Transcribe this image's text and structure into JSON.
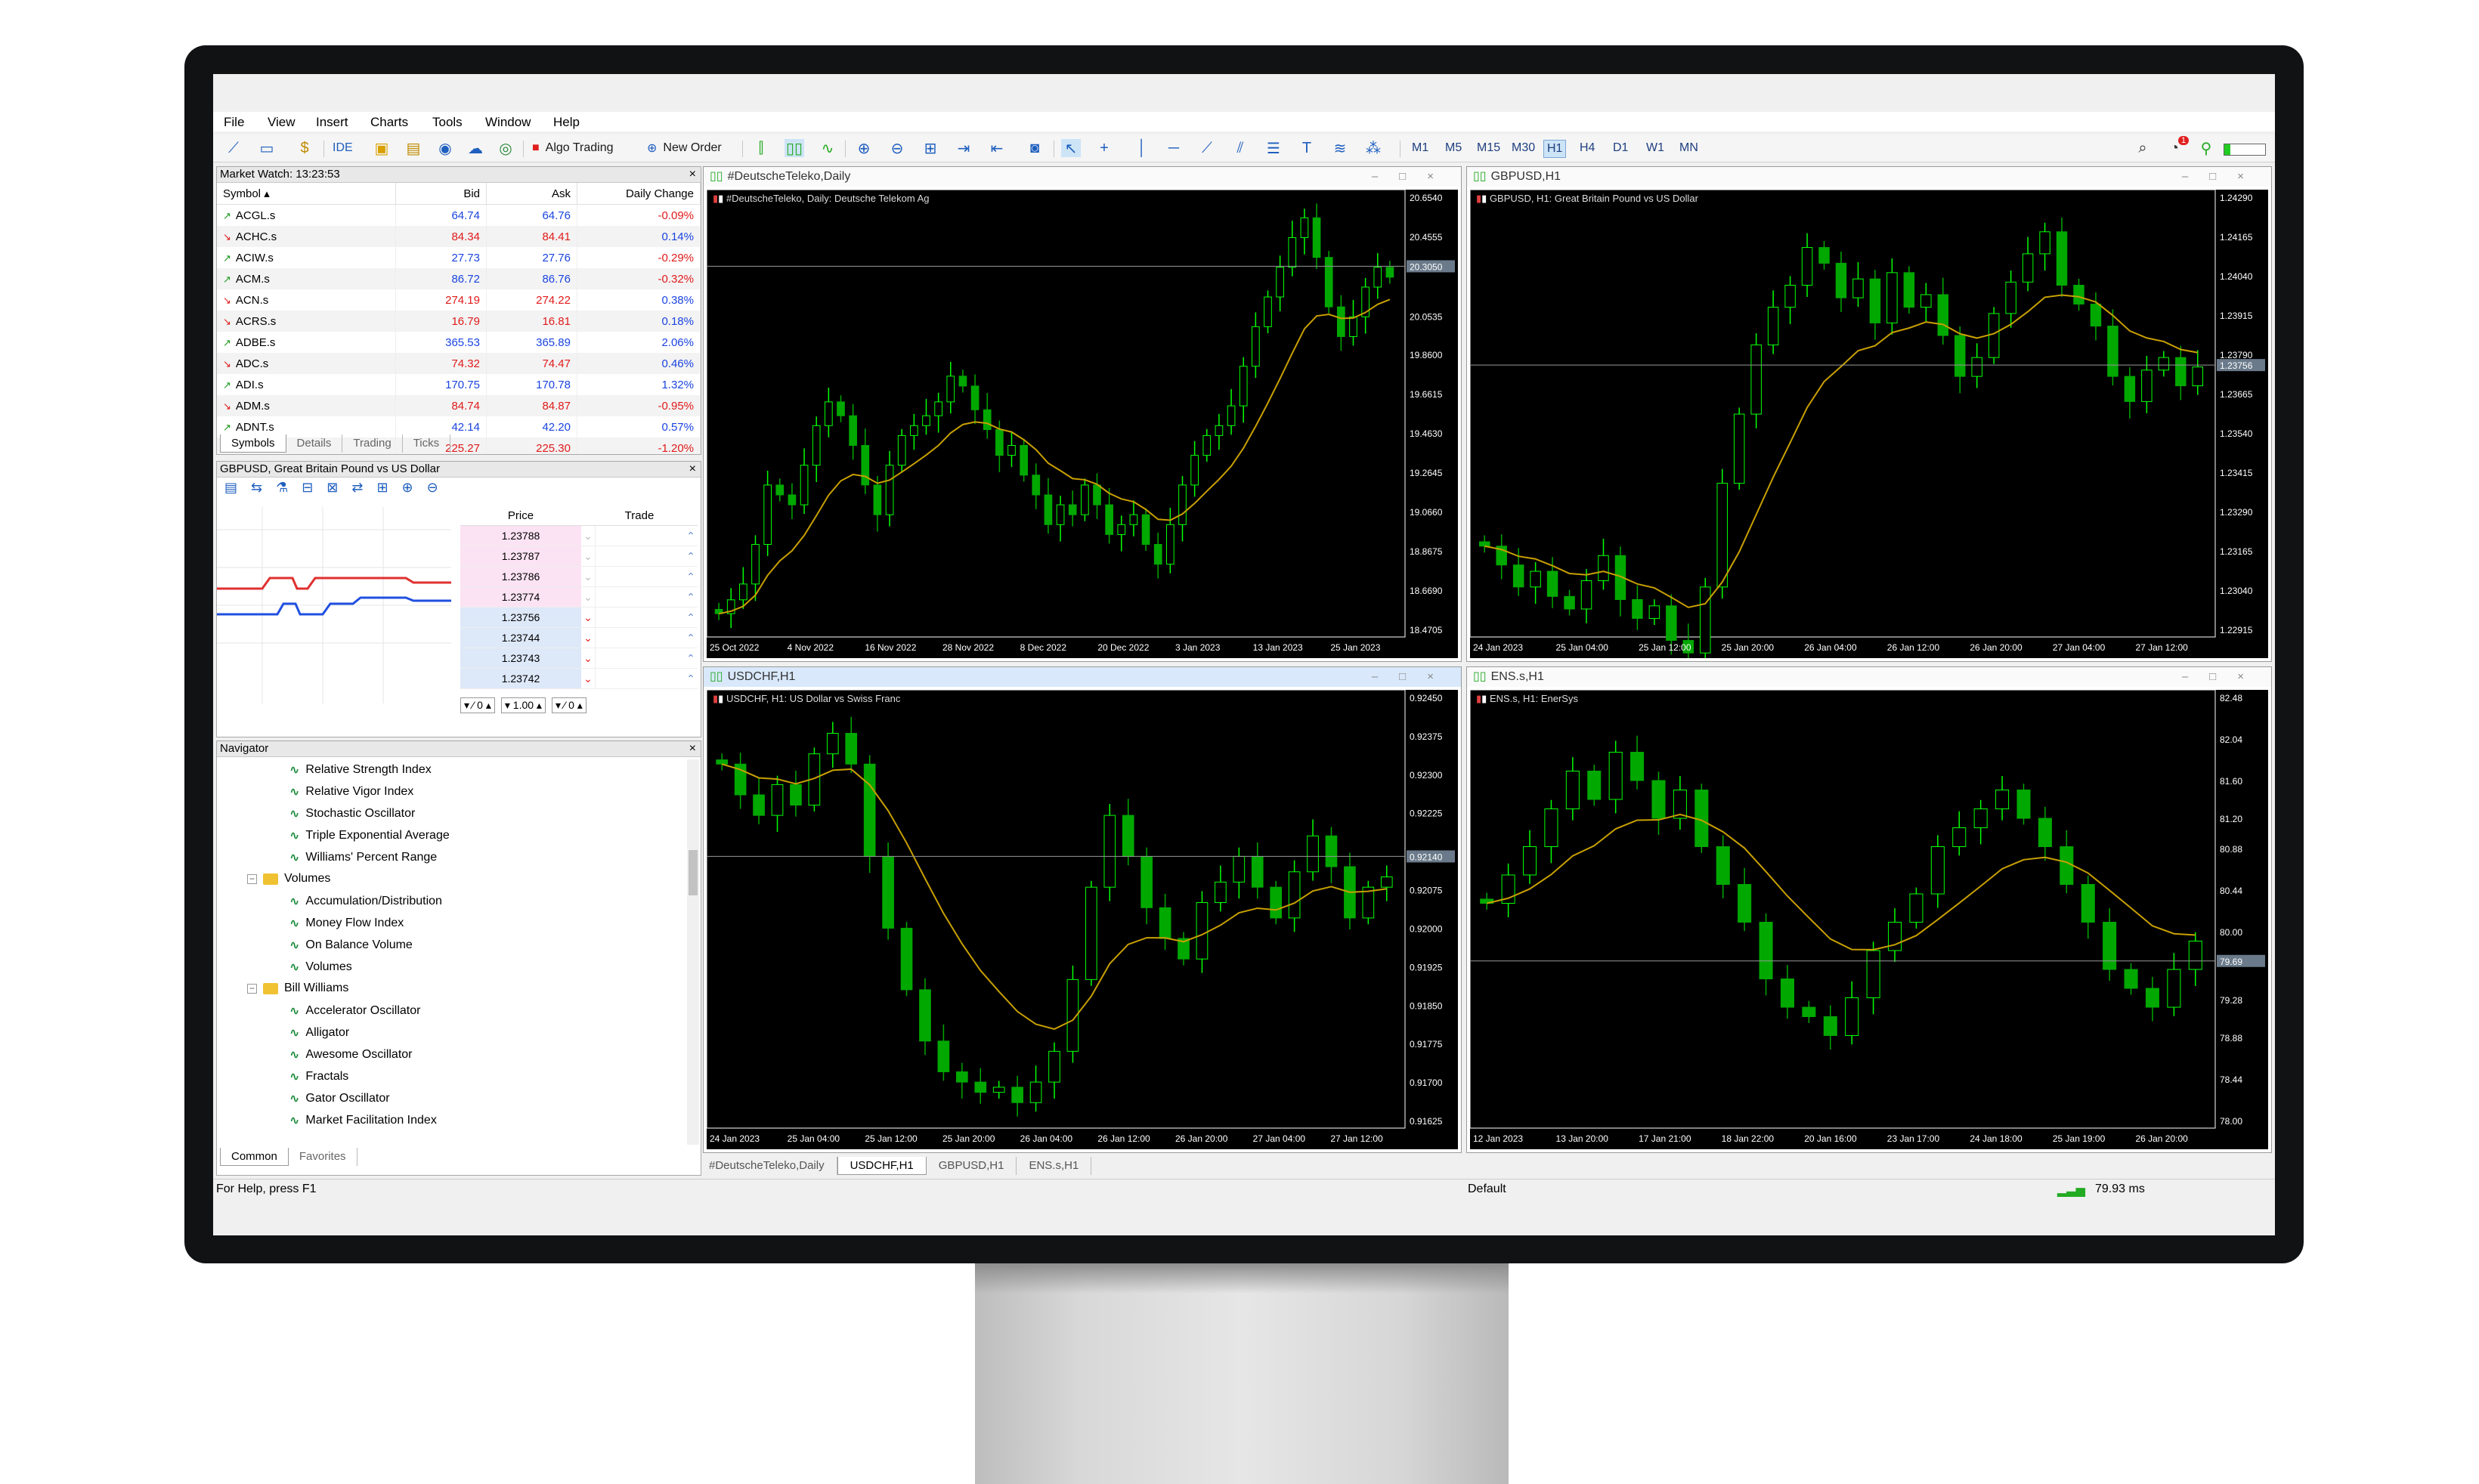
{
  "menu": [
    "File",
    "View",
    "Insert",
    "Charts",
    "Tools",
    "Window",
    "Help"
  ],
  "toolbar": {
    "ide_label": "IDE",
    "algo_label": "Algo Trading",
    "new_order_label": "New Order",
    "timeframes": [
      "M1",
      "M5",
      "M15",
      "M30",
      "H1",
      "H4",
      "D1",
      "W1",
      "MN"
    ],
    "active_timeframe": "H1",
    "notification_count": "1"
  },
  "market_watch": {
    "title": "Market Watch: 13:23:53",
    "columns": {
      "symbol": "Symbol",
      "bid": "Bid",
      "ask": "Ask",
      "change": "Daily Change"
    },
    "rows": [
      {
        "symbol": "ACGL.s",
        "bid": "64.74",
        "ask": "64.76",
        "change": "-0.09%",
        "dir": "up",
        "chg_dir": "dn"
      },
      {
        "symbol": "ACHC.s",
        "bid": "84.34",
        "ask": "84.41",
        "change": "0.14%",
        "dir": "dn",
        "chg_dir": "up"
      },
      {
        "symbol": "ACIW.s",
        "bid": "27.73",
        "ask": "27.76",
        "change": "-0.29%",
        "dir": "up",
        "chg_dir": "dn"
      },
      {
        "symbol": "ACM.s",
        "bid": "86.72",
        "ask": "86.76",
        "change": "-0.32%",
        "dir": "up",
        "chg_dir": "dn"
      },
      {
        "symbol": "ACN.s",
        "bid": "274.19",
        "ask": "274.22",
        "change": "0.38%",
        "dir": "dn",
        "chg_dir": "up"
      },
      {
        "symbol": "ACRS.s",
        "bid": "16.79",
        "ask": "16.81",
        "change": "0.18%",
        "dir": "dn",
        "chg_dir": "up"
      },
      {
        "symbol": "ADBE.s",
        "bid": "365.53",
        "ask": "365.89",
        "change": "2.06%",
        "dir": "up",
        "chg_dir": "up"
      },
      {
        "symbol": "ADC.s",
        "bid": "74.32",
        "ask": "74.47",
        "change": "0.46%",
        "dir": "dn",
        "chg_dir": "up"
      },
      {
        "symbol": "ADI.s",
        "bid": "170.75",
        "ask": "170.78",
        "change": "1.32%",
        "dir": "up",
        "chg_dir": "up"
      },
      {
        "symbol": "ADM.s",
        "bid": "84.74",
        "ask": "84.87",
        "change": "-0.95%",
        "dir": "dn",
        "chg_dir": "dn"
      },
      {
        "symbol": "ADNT.s",
        "bid": "42.14",
        "ask": "42.20",
        "change": "0.57%",
        "dir": "up",
        "chg_dir": "up"
      },
      {
        "symbol": "ADP.s",
        "bid": "225.27",
        "ask": "225.30",
        "change": "-1.20%",
        "dir": "dn",
        "chg_dir": "dn"
      }
    ],
    "tabs": [
      "Symbols",
      "Details",
      "Trading",
      "Ticks"
    ]
  },
  "depth": {
    "title": "GBPUSD, Great Britain Pound vs US Dollar",
    "col_price": "Price",
    "col_trade": "Trade",
    "ask_prices": [
      "1.23788",
      "1.23787",
      "1.23786",
      "1.23774"
    ],
    "bid_prices": [
      "1.23756",
      "1.23744",
      "1.23743",
      "1.23742"
    ],
    "sl": "0",
    "volume": "1.00",
    "tp": "0"
  },
  "navigator": {
    "title": "Navigator",
    "items": [
      {
        "label": "Relative Strength Index",
        "type": "ind"
      },
      {
        "label": "Relative Vigor Index",
        "type": "ind"
      },
      {
        "label": "Stochastic Oscillator",
        "type": "ind"
      },
      {
        "label": "Triple Exponential Average",
        "type": "ind"
      },
      {
        "label": "Williams' Percent Range",
        "type": "ind"
      },
      {
        "label": "Volumes",
        "type": "folder"
      },
      {
        "label": "Accumulation/Distribution",
        "type": "ind"
      },
      {
        "label": "Money Flow Index",
        "type": "ind"
      },
      {
        "label": "On Balance Volume",
        "type": "ind"
      },
      {
        "label": "Volumes",
        "type": "ind"
      },
      {
        "label": "Bill Williams",
        "type": "folder"
      },
      {
        "label": "Accelerator Oscillator",
        "type": "ind"
      },
      {
        "label": "Alligator",
        "type": "ind"
      },
      {
        "label": "Awesome Oscillator",
        "type": "ind"
      },
      {
        "label": "Fractals",
        "type": "ind"
      },
      {
        "label": "Gator Oscillator",
        "type": "ind"
      },
      {
        "label": "Market Facilitation Index",
        "type": "ind"
      }
    ],
    "tabs": [
      "Common",
      "Favorites"
    ]
  },
  "charts": [
    {
      "window_title": "#DeutscheTeleko,Daily",
      "label": "#DeutscheTeleko, Daily:  Deutsche Telekom Ag",
      "price_labels": [
        "20.6540",
        "20.4555",
        "20.3050",
        "20.0535",
        "19.8600",
        "19.6615",
        "19.4630",
        "19.2645",
        "19.0660",
        "18.8675",
        "18.6690",
        "18.4705"
      ],
      "current": "20.3050",
      "time_labels": [
        "25 Oct 2022",
        "4 Nov 2022",
        "16 Nov 2022",
        "28 Nov 2022",
        "8 Dec 2022",
        "20 Dec 2022",
        "3 Jan 2023",
        "13 Jan 2023",
        "25 Jan 2023"
      ],
      "series": [
        18.55,
        18.62,
        18.7,
        18.9,
        19.2,
        19.15,
        19.1,
        19.3,
        19.5,
        19.62,
        19.55,
        19.4,
        19.2,
        19.05,
        19.3,
        19.45,
        19.5,
        19.55,
        19.62,
        19.75,
        19.7,
        19.58,
        19.48,
        19.35,
        19.4,
        19.25,
        19.15,
        19.0,
        19.1,
        19.05,
        19.2,
        19.1,
        18.95,
        19.0,
        19.05,
        18.9,
        18.8,
        19.0,
        19.2,
        19.35,
        19.45,
        19.5,
        19.6,
        19.8,
        20.0,
        20.15,
        20.3,
        20.45,
        20.55,
        20.35,
        20.1,
        19.95,
        20.05,
        20.2,
        20.3,
        20.25
      ]
    },
    {
      "window_title": "GBPUSD,H1",
      "label": "GBPUSD, H1:  Great Britain Pound vs US Dollar",
      "price_labels": [
        "1.24290",
        "1.24165",
        "1.24040",
        "1.23915",
        "1.23790",
        "1.23665",
        "1.23540",
        "1.23415",
        "1.23290",
        "1.23165",
        "1.23040",
        "1.22915"
      ],
      "current": "1.23756",
      "time_labels": [
        "24 Jan 2023",
        "25 Jan 04:00",
        "25 Jan 12:00",
        "25 Jan 20:00",
        "26 Jan 04:00",
        "26 Jan 12:00",
        "26 Jan 20:00",
        "27 Jan 04:00",
        "27 Jan 12:00"
      ],
      "series": [
        1.2318,
        1.2312,
        1.2305,
        1.231,
        1.2302,
        1.2298,
        1.2307,
        1.2315,
        1.2301,
        1.2295,
        1.2299,
        1.2288,
        1.2284,
        1.2305,
        1.2338,
        1.236,
        1.2382,
        1.2394,
        1.2401,
        1.2413,
        1.2408,
        1.2397,
        1.2403,
        1.2389,
        1.2405,
        1.2394,
        1.2398,
        1.2385,
        1.2372,
        1.2378,
        1.2392,
        1.2402,
        1.2411,
        1.2418,
        1.2401,
        1.2395,
        1.2388,
        1.2372,
        1.2364,
        1.2374,
        1.2378,
        1.2369,
        1.2375
      ]
    },
    {
      "window_title": "USDCHF,H1",
      "label": "USDCHF, H1:  US Dollar vs Swiss Franc",
      "price_labels": [
        "0.92450",
        "0.92375",
        "0.92300",
        "0.92225",
        "0.92140",
        "0.92075",
        "0.92000",
        "0.91925",
        "0.91850",
        "0.91775",
        "0.91700",
        "0.91625"
      ],
      "current": "0.92140",
      "time_labels": [
        "24 Jan 2023",
        "25 Jan 04:00",
        "25 Jan 12:00",
        "25 Jan 20:00",
        "26 Jan 04:00",
        "26 Jan 12:00",
        "26 Jan 20:00",
        "27 Jan 04:00",
        "27 Jan 12:00"
      ],
      "series": [
        0.9232,
        0.9226,
        0.9222,
        0.9228,
        0.9224,
        0.9234,
        0.9238,
        0.9232,
        0.9214,
        0.92,
        0.9188,
        0.9178,
        0.9172,
        0.917,
        0.9168,
        0.9169,
        0.9166,
        0.917,
        0.9176,
        0.919,
        0.9208,
        0.9222,
        0.9214,
        0.9204,
        0.9198,
        0.9194,
        0.9205,
        0.9209,
        0.9214,
        0.9208,
        0.9202,
        0.9211,
        0.9218,
        0.9212,
        0.9202,
        0.9208,
        0.921
      ]
    },
    {
      "window_title": "ENS.s,H1",
      "label": "ENS.s, H1:  EnerSys",
      "price_labels": [
        "82.48",
        "82.04",
        "81.60",
        "81.20",
        "80.88",
        "80.44",
        "80.00",
        "79.69",
        "79.28",
        "78.88",
        "78.44",
        "78.00"
      ],
      "current": "79.69",
      "time_labels": [
        "12 Jan 2023",
        "13 Jan 20:00",
        "17 Jan 21:00",
        "18 Jan 22:00",
        "20 Jan 16:00",
        "23 Jan 17:00",
        "24 Jan 18:00",
        "25 Jan 19:00",
        "26 Jan 20:00"
      ],
      "series": [
        80.3,
        80.6,
        80.9,
        81.3,
        81.7,
        81.4,
        81.9,
        81.6,
        81.2,
        81.5,
        80.9,
        80.5,
        80.1,
        79.5,
        79.2,
        79.1,
        78.9,
        79.3,
        79.8,
        80.1,
        80.4,
        80.9,
        81.1,
        81.3,
        81.5,
        81.2,
        80.9,
        80.5,
        80.1,
        79.6,
        79.4,
        79.2,
        79.6,
        79.9
      ]
    }
  ],
  "bottom_tabs": [
    "#DeutscheTeleko,Daily",
    "USDCHF,H1",
    "GBPUSD,H1",
    "ENS.s,H1"
  ],
  "active_bottom_tab": "USDCHF,H1",
  "status": {
    "help": "For Help, press F1",
    "profile": "Default",
    "ping": "79.93 ms"
  },
  "colors": {
    "bull": "#00ff00",
    "bear": "#00a800",
    "ma": "#c8a000",
    "chart_bg": "#000000"
  }
}
